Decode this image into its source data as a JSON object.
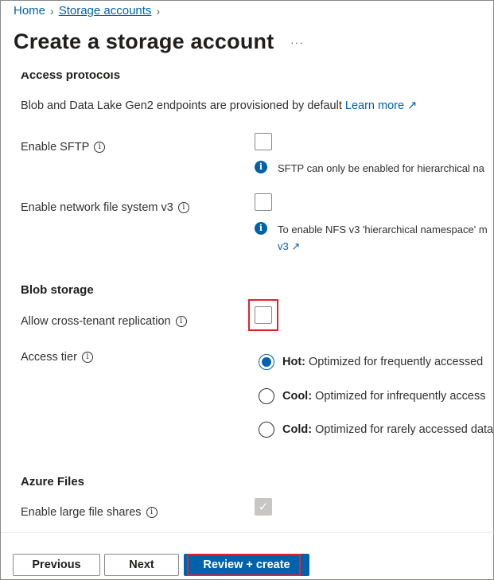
{
  "breadcrumb": {
    "home": "Home",
    "sep1": "›",
    "storage": "Storage accounts",
    "sep2": "›"
  },
  "page": {
    "title": "Create a storage account",
    "more": "···"
  },
  "access_protocols": {
    "heading": "Access protocols",
    "description": "Blob and Data Lake Gen2 endpoints are provisioned by default",
    "learn_more": "Learn more",
    "external_icon": "↗",
    "sftp": {
      "label": "Enable SFTP",
      "checked": false,
      "note": "SFTP can only be enabled for hierarchical na"
    },
    "nfs": {
      "label": "Enable network file system v3",
      "checked": false,
      "note_line1": "To enable NFS v3 'hierarchical namespace' m",
      "note_line2": "v3"
    }
  },
  "blob_storage": {
    "heading": "Blob storage",
    "cross_tenant": {
      "label": "Allow cross-tenant replication",
      "checked": false
    },
    "access_tier": {
      "label": "Access tier",
      "selected": "Hot",
      "options": [
        {
          "name": "Hot:",
          "desc": "Optimized for frequently accessed"
        },
        {
          "name": "Cool:",
          "desc": "Optimized for infrequently access"
        },
        {
          "name": "Cold:",
          "desc": "Optimized for rarely accessed data"
        }
      ]
    }
  },
  "azure_files": {
    "heading": "Azure Files",
    "large_shares": {
      "label": "Enable large file shares",
      "checked": true,
      "disabled": true
    }
  },
  "footer": {
    "previous": "Previous",
    "next": "Next",
    "review_create": "Review + create"
  },
  "icons": {
    "info": "i",
    "check": "✓"
  },
  "colors": {
    "accent": "#0062ad",
    "highlight": "#e3232a",
    "disabled": "#c8c6c4"
  }
}
